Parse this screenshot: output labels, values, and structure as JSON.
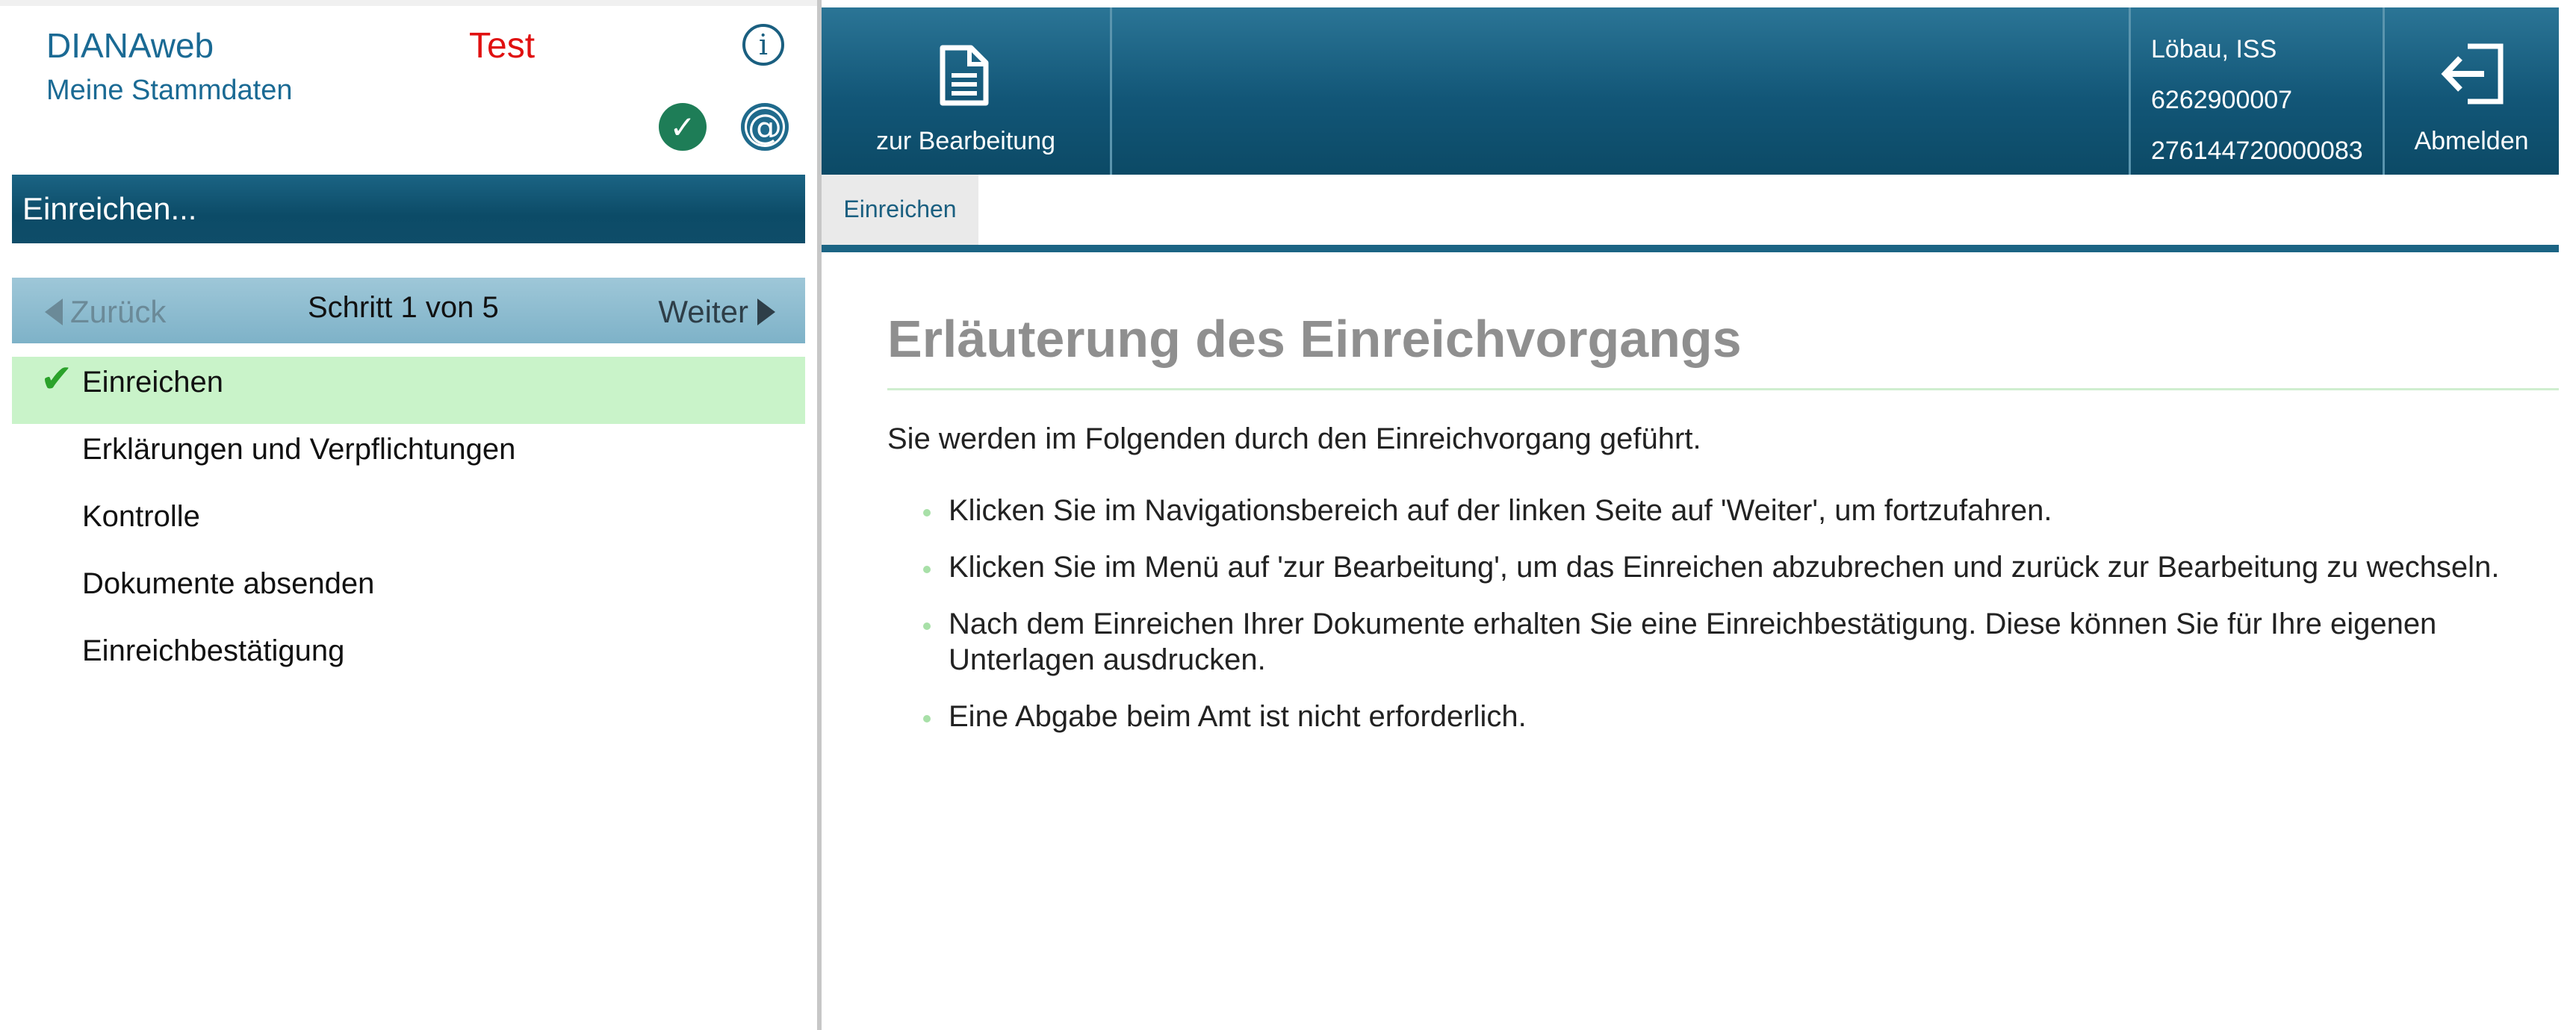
{
  "app": {
    "title": "DIANAweb",
    "subtitle": "Meine Stammdaten",
    "environment": "Test",
    "icons": [
      "info-icon",
      "check-icon",
      "at-icon"
    ]
  },
  "left_panel": {
    "header": "Einreichen...",
    "stepper": {
      "back_label": "Zurück",
      "step_label": "Schritt 1 von 5",
      "next_label": "Weiter"
    },
    "steps": [
      {
        "label": "Einreichen",
        "active": true,
        "done": true
      },
      {
        "label": "Erklärungen und Verpflichtungen",
        "active": false
      },
      {
        "label": "Kontrolle",
        "active": false
      },
      {
        "label": "Dokumente absenden",
        "active": false
      },
      {
        "label": "Einreichbestätigung",
        "active": false
      }
    ]
  },
  "topbar": {
    "edit_label": "zur Bearbeitung",
    "user": {
      "office": "Löbau, ISS",
      "number1": "6262900007",
      "number2": "276144720000083"
    },
    "logout_label": "Abmelden"
  },
  "tabs": [
    {
      "label": "Einreichen",
      "active": true
    }
  ],
  "content": {
    "heading": "Erläuterung des Einreichvorgangs",
    "intro": "Sie werden im Folgenden durch den Einreichvorgang geführt.",
    "bullets": [
      "Klicken Sie im Navigationsbereich auf der linken Seite auf 'Weiter', um fortzufahren.",
      "Klicken Sie im Menü auf 'zur Bearbeitung', um das Einreichen abzubrechen und zurück zur Bearbeitung zu wechseln.",
      "Nach dem Einreichen Ihrer Dokumente erhalten Sie eine Einreichbestätigung. Diese können Sie für Ihre eigenen Unterlagen ausdrucken.",
      "Eine Abgabe beim Amt ist nicht erforderlich."
    ]
  },
  "colors": {
    "brand_blue": "#125677",
    "title_blue": "#1a6a94",
    "test_red": "#e01010",
    "active_step_bg": "#c9f3c9",
    "check_green": "#2aa22a"
  }
}
